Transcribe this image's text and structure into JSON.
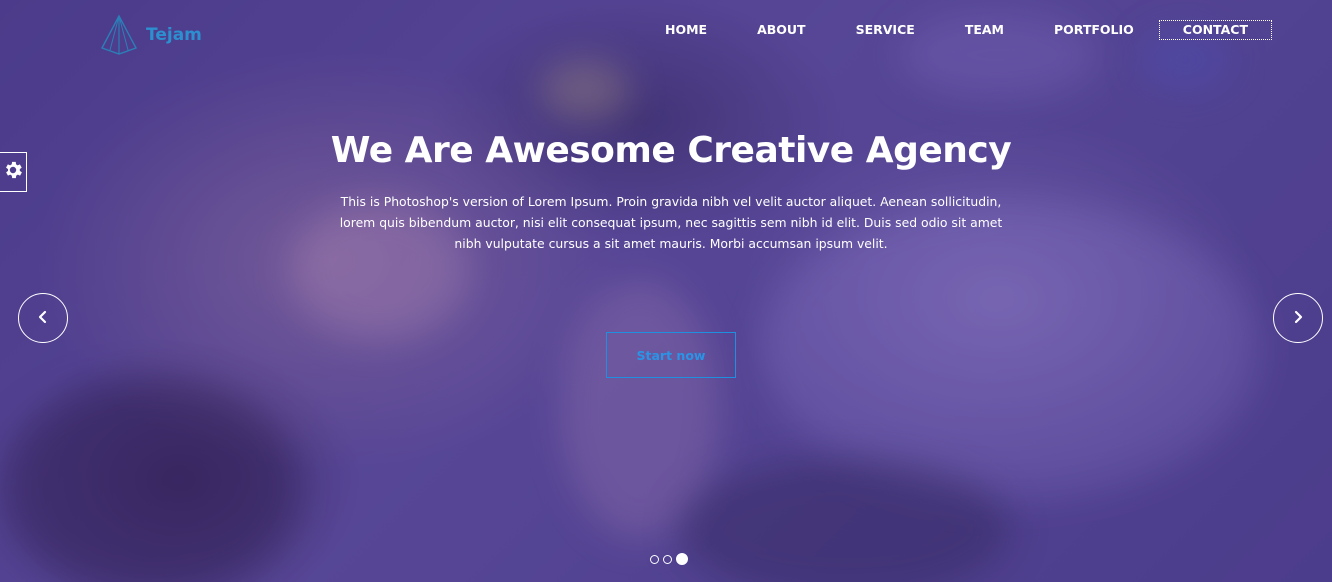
{
  "brand": {
    "name": "Tejam",
    "color": "#2c8fd0"
  },
  "nav": {
    "items": [
      {
        "label": "HOME"
      },
      {
        "label": "ABOUT"
      },
      {
        "label": "SERVICE"
      },
      {
        "label": "TEAM"
      },
      {
        "label": "PORTFOLIO"
      },
      {
        "label": "CONTACT"
      }
    ],
    "active": "CONTACT"
  },
  "hero": {
    "title": "We Are Awesome Creative Agency",
    "description": "This is Photoshop's version of Lorem Ipsum. Proin gravida nibh vel velit auctor aliquet. Aenean sollicitudin, lorem quis bibendum auctor, nisi elit consequat ipsum, nec sagittis sem nibh id elit. Duis sed odio sit amet nibh vulputate cursus a sit amet mauris. Morbi accumsan ipsum velit.",
    "cta_label": "Start now",
    "cta_color": "#2a94e6"
  },
  "slider": {
    "prev_icon": "chevron-left-icon",
    "next_icon": "chevron-right-icon",
    "slide_count": 3,
    "active_slide": 3
  },
  "settings": {
    "icon": "gear-icon"
  },
  "colors": {
    "overlay": "#4f3f8f",
    "text": "#ffffff"
  }
}
